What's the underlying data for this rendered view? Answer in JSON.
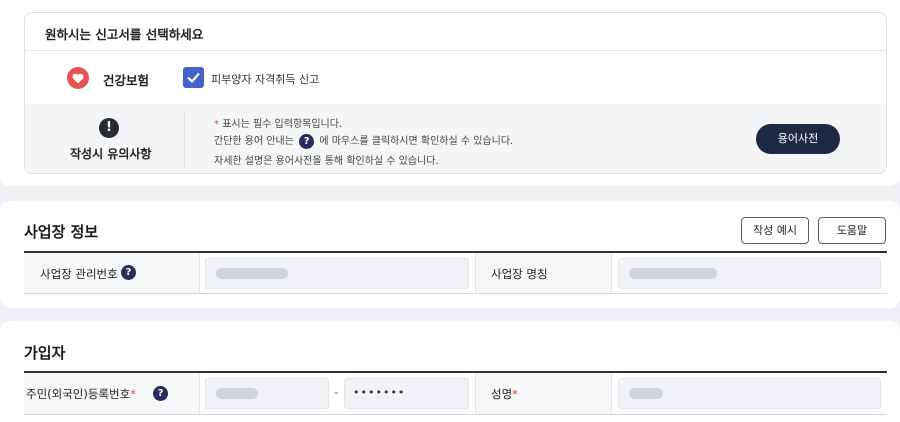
{
  "selection": {
    "title": "원하시는 신고서를 선택하세요",
    "insurance": "건강보험",
    "icon": "heart-icon",
    "checkbox_label": "피부양자 자격취득 신고",
    "checkbox_checked": true
  },
  "notice": {
    "title": "작성시 유의사항",
    "icon": "exclamation-icon",
    "star": "*",
    "line1": "표시는 필수 입력항목입니다.",
    "line2_pre": "간단한 용어 안내는",
    "line2_post": "에 마우스를 클릭하시면 확인하실 수 있습니다.",
    "line3": "자세한 설명은 용어사전을 통해 확인하실 수 있습니다.",
    "help_glyph": "?",
    "dict_button": "용어사전"
  },
  "workplace": {
    "title": "사업장 정보",
    "example_button": "작성 예시",
    "help_button": "도움말",
    "mgmt_no_label": "사업장 관리번호",
    "name_label": "사업장 명칭",
    "help_glyph": "?"
  },
  "subscriber": {
    "title": "가입자",
    "rrn_label": "주민(외국인)등록번호",
    "required_mark": "*",
    "rrn_dash": "-",
    "rrn_back_masked": "•••••••",
    "name_label": "성명",
    "help_glyph": "?"
  },
  "colors": {
    "accent": "#4263c9",
    "dark_button": "#1f2845",
    "required": "#e04a3a",
    "heart": "#e8524f"
  }
}
